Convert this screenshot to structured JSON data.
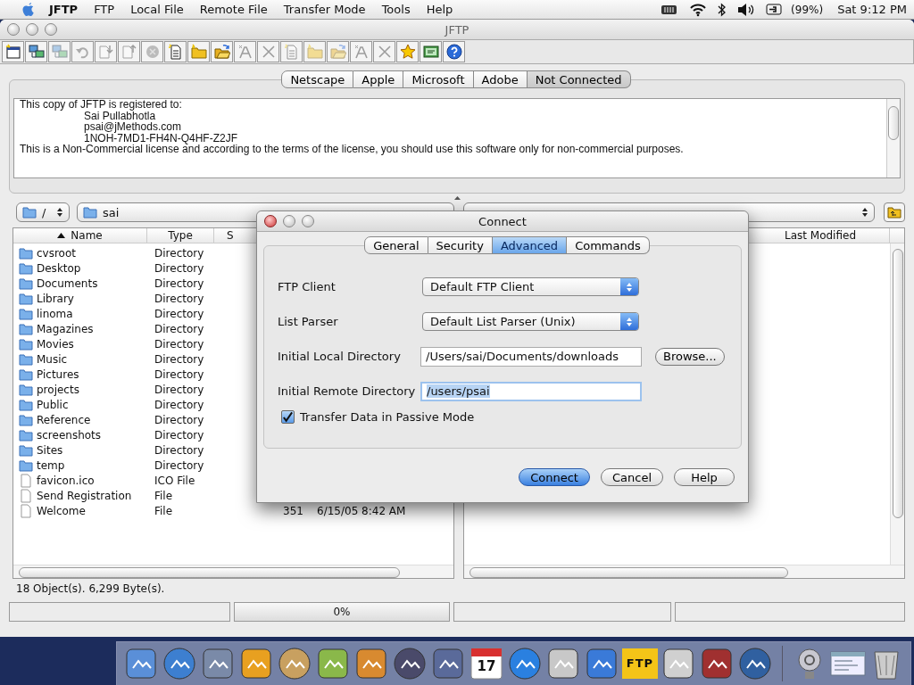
{
  "menubar": {
    "app": "JFTP",
    "menus": [
      "FTP",
      "Local File",
      "Remote File",
      "Transfer Mode",
      "Tools",
      "Help"
    ],
    "battery": "(99%)",
    "clock": "Sat 9:12 PM"
  },
  "window": {
    "title": "JFTP"
  },
  "sites": [
    {
      "label": "Netscape",
      "selected": false
    },
    {
      "label": "Apple",
      "selected": false
    },
    {
      "label": "Microsoft",
      "selected": false
    },
    {
      "label": "Adobe",
      "selected": false
    },
    {
      "label": "Not Connected",
      "selected": true
    }
  ],
  "log": [
    {
      "text": "This copy of JFTP is registered to:",
      "indented": false
    },
    {
      "text": "Sai Pullabhotla",
      "indented": true
    },
    {
      "text": "psai@jMethods.com",
      "indented": true
    },
    {
      "text": "1NOH-7MD1-FH4N-Q4HF-Z2JF",
      "indented": true
    },
    {
      "text": "This is a Non-Commercial license and according to the terms of the license, you should use this software only for non-commercial purposes.",
      "indented": false
    }
  ],
  "local": {
    "drive": "/",
    "path": "sai",
    "columns": [
      {
        "label": "Name",
        "sorted": true
      },
      {
        "label": "Type",
        "sorted": false
      },
      {
        "label": "S",
        "sorted": false
      }
    ],
    "rows": [
      {
        "name": "cvsroot",
        "type": "Directory",
        "kind": "folder"
      },
      {
        "name": "Desktop",
        "type": "Directory",
        "kind": "folder"
      },
      {
        "name": "Documents",
        "type": "Directory",
        "kind": "folder"
      },
      {
        "name": "Library",
        "type": "Directory",
        "kind": "folder"
      },
      {
        "name": "linoma",
        "type": "Directory",
        "kind": "folder"
      },
      {
        "name": "Magazines",
        "type": "Directory",
        "kind": "folder"
      },
      {
        "name": "Movies",
        "type": "Directory",
        "kind": "folder"
      },
      {
        "name": "Music",
        "type": "Directory",
        "kind": "folder"
      },
      {
        "name": "Pictures",
        "type": "Directory",
        "kind": "folder"
      },
      {
        "name": "projects",
        "type": "Directory",
        "kind": "folder"
      },
      {
        "name": "Public",
        "type": "Directory",
        "kind": "folder"
      },
      {
        "name": "Reference",
        "type": "Directory",
        "kind": "folder"
      },
      {
        "name": "screenshots",
        "type": "Directory",
        "kind": "folder"
      },
      {
        "name": "Sites",
        "type": "Directory",
        "kind": "folder"
      },
      {
        "name": "temp",
        "type": "Directory",
        "kind": "folder"
      },
      {
        "name": "favicon.ico",
        "type": "ICO File",
        "kind": "file"
      },
      {
        "name": "Send Registration",
        "type": "File",
        "kind": "file"
      },
      {
        "name": "Welcome",
        "type": "File",
        "kind": "file",
        "size": "351",
        "modified": "6/15/05 8:42 AM"
      }
    ],
    "status": "18 Object(s). 6,299 Byte(s)."
  },
  "remote": {
    "columns": [
      {
        "label": "Last Modified",
        "sorted": false
      }
    ]
  },
  "progress": {
    "level": 0,
    "reading": "0%"
  },
  "dialog": {
    "title": "Connect",
    "tabs": [
      {
        "label": "General",
        "selected": false
      },
      {
        "label": "Security",
        "selected": false
      },
      {
        "label": "Advanced",
        "selected": true
      },
      {
        "label": "Commands",
        "selected": false
      }
    ],
    "fields": [
      {
        "label": "FTP Client",
        "kind": "select",
        "value": "Default FTP Client"
      },
      {
        "label": "List Parser",
        "kind": "select",
        "value": "Default List Parser (Unix)"
      },
      {
        "label": "Initial Local Directory",
        "kind": "text",
        "value": "/Users/sai/Documents/downloads",
        "button": "Browse...",
        "focused": false
      },
      {
        "label": "Initial Remote Directory",
        "kind": "text",
        "value": "/users/psai",
        "focused": true
      }
    ],
    "passive": {
      "label": "Transfer Data in Passive Mode",
      "checked": true
    },
    "buttons": [
      {
        "label": "Connect",
        "default": true
      },
      {
        "label": "Cancel",
        "default": false
      },
      {
        "label": "Help",
        "default": false
      }
    ]
  },
  "dock": {
    "ftp_label": "FTP",
    "calendar_day": "17"
  }
}
